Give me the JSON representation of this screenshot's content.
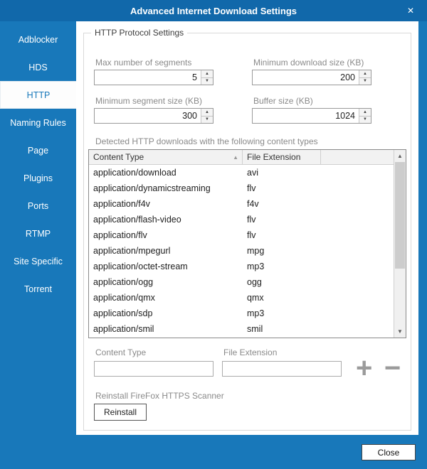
{
  "window": {
    "title": "Advanced Internet Download Settings",
    "icons": {
      "close": "✕"
    }
  },
  "colors": {
    "accent": "#1878ba",
    "titlebar": "#1168aa"
  },
  "sidebar": {
    "selected": "HTTP",
    "items": [
      {
        "label": "Adblocker"
      },
      {
        "label": "HDS"
      },
      {
        "label": "HTTP"
      },
      {
        "label": "Naming Rules"
      },
      {
        "label": "Page"
      },
      {
        "label": "Plugins"
      },
      {
        "label": "Ports"
      },
      {
        "label": "RTMP"
      },
      {
        "label": "Site Specific"
      },
      {
        "label": "Torrent"
      }
    ]
  },
  "group": {
    "title": "HTTP Protocol Settings",
    "fields": [
      {
        "label": "Max number of segments",
        "value": "5"
      },
      {
        "label": "Minimum download size (KB)",
        "value": "200"
      },
      {
        "label": "Minimum segment size (KB)",
        "value": "300"
      },
      {
        "label": "Buffer size (KB)",
        "value": "1024"
      }
    ],
    "spinner_icons": {
      "up": "▲",
      "down": "▼"
    },
    "table_caption": "Detected HTTP downloads with the following content types",
    "table": {
      "headers": [
        "Content Type",
        "File Extension"
      ],
      "sort_icon": "▲",
      "rows": [
        [
          "application/download",
          "avi"
        ],
        [
          "application/dynamicstreaming",
          "flv"
        ],
        [
          "application/f4v",
          "f4v"
        ],
        [
          "application/flash-video",
          "flv"
        ],
        [
          "application/flv",
          "flv"
        ],
        [
          "application/mpegurl",
          "mpg"
        ],
        [
          "application/octet-stream",
          "mp3"
        ],
        [
          "application/ogg",
          "ogg"
        ],
        [
          "application/qmx",
          "qmx"
        ],
        [
          "application/sdp",
          "mp3"
        ],
        [
          "application/smil",
          "smil"
        ]
      ]
    },
    "scrollbar_icons": {
      "up": "▲",
      "down": "▼"
    },
    "add_row": {
      "content_type_label": "Content Type",
      "file_extension_label": "File Extension",
      "content_type_value": "",
      "file_extension_value": "",
      "add_icon": "+",
      "remove_icon": "−"
    },
    "reinstall": {
      "label": "Reinstall FireFox HTTPS Scanner",
      "button": "Reinstall"
    }
  },
  "footer": {
    "close_button": "Close"
  }
}
